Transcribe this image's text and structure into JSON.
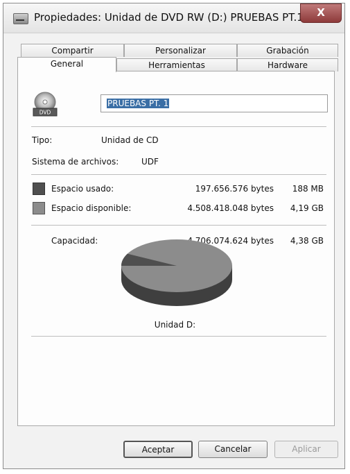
{
  "window": {
    "title": "Propiedades: Unidad de DVD RW (D:) PRUEBAS PT.1",
    "close_glyph": "X"
  },
  "tabs": {
    "row1": [
      {
        "label": "Compartir"
      },
      {
        "label": "Personalizar"
      },
      {
        "label": "Grabación"
      }
    ],
    "row2": [
      {
        "label": "General",
        "active": true
      },
      {
        "label": "Herramientas"
      },
      {
        "label": "Hardware"
      }
    ]
  },
  "general": {
    "icon_name": "dvd-drive-icon",
    "icon_label": "DVD",
    "volume_name": "PRUEBAS PT. 1",
    "type_label": "Tipo:",
    "type_value": "Unidad de CD",
    "fs_label": "Sistema de archivos:",
    "fs_value": "UDF",
    "used": {
      "label": "Espacio usado:",
      "bytes": "197.656.576 bytes",
      "size": "188 MB",
      "color": "#4f4f4f"
    },
    "free": {
      "label": "Espacio disponible:",
      "bytes": "4.508.418.048 bytes",
      "size": "4,19 GB",
      "color": "#8c8c8c"
    },
    "capacity": {
      "label": "Capacidad:",
      "bytes": "4.706.074.624 bytes",
      "size": "4,38 GB"
    },
    "used_fraction": 0.042,
    "drive_label": "Unidad D:"
  },
  "buttons": {
    "ok": "Aceptar",
    "cancel": "Cancelar",
    "apply": "Aplicar"
  }
}
